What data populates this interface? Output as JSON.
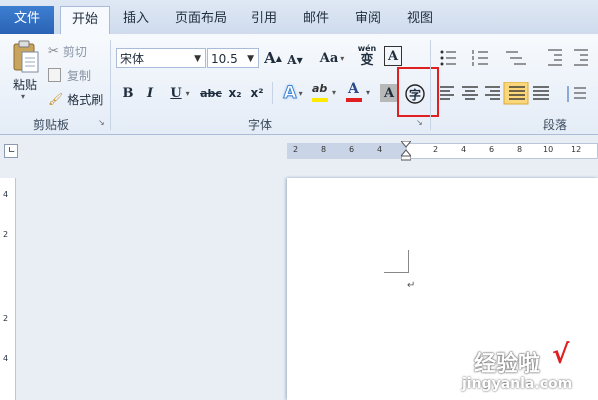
{
  "tabs": {
    "file": "文件",
    "items": [
      "开始",
      "插入",
      "页面布局",
      "引用",
      "邮件",
      "审阅",
      "视图"
    ]
  },
  "clipboard": {
    "paste_label": "粘贴",
    "cut_label": "剪切",
    "copy_label": "复制",
    "format_painter_label": "格式刷",
    "group_label": "剪贴板"
  },
  "font": {
    "font_name": "宋体",
    "font_size": "10.5",
    "grow_label": "A",
    "shrink_label": "A",
    "case_label": "Aa",
    "phonetic_label": "wén",
    "phonetic_char": "变",
    "border_char": "A",
    "bold": "B",
    "italic": "I",
    "underline": "U",
    "strike": "abc",
    "subscript": "x₂",
    "superscript": "x²",
    "text_effect": "A",
    "highlight": "ab",
    "font_color": "A",
    "shading": "A",
    "enclosed_char": "字",
    "group_label": "字体"
  },
  "paragraph": {
    "group_label": "段落"
  },
  "ruler": {
    "left_marks": [
      "8",
      "6",
      "4",
      "2"
    ],
    "right_marks": [
      "2",
      "4",
      "6",
      "8",
      "10",
      "12"
    ],
    "vertical_marks": [
      "4",
      "2",
      "2",
      "4"
    ]
  },
  "watermark": {
    "title": "经验啦",
    "check": "√",
    "url": "jingyanla.com"
  },
  "colors": {
    "highlight_box": "#e02020",
    "accent": "#2a63b5",
    "font_color_bar": "#e02020",
    "highlight_bar": "#ffeb00"
  }
}
